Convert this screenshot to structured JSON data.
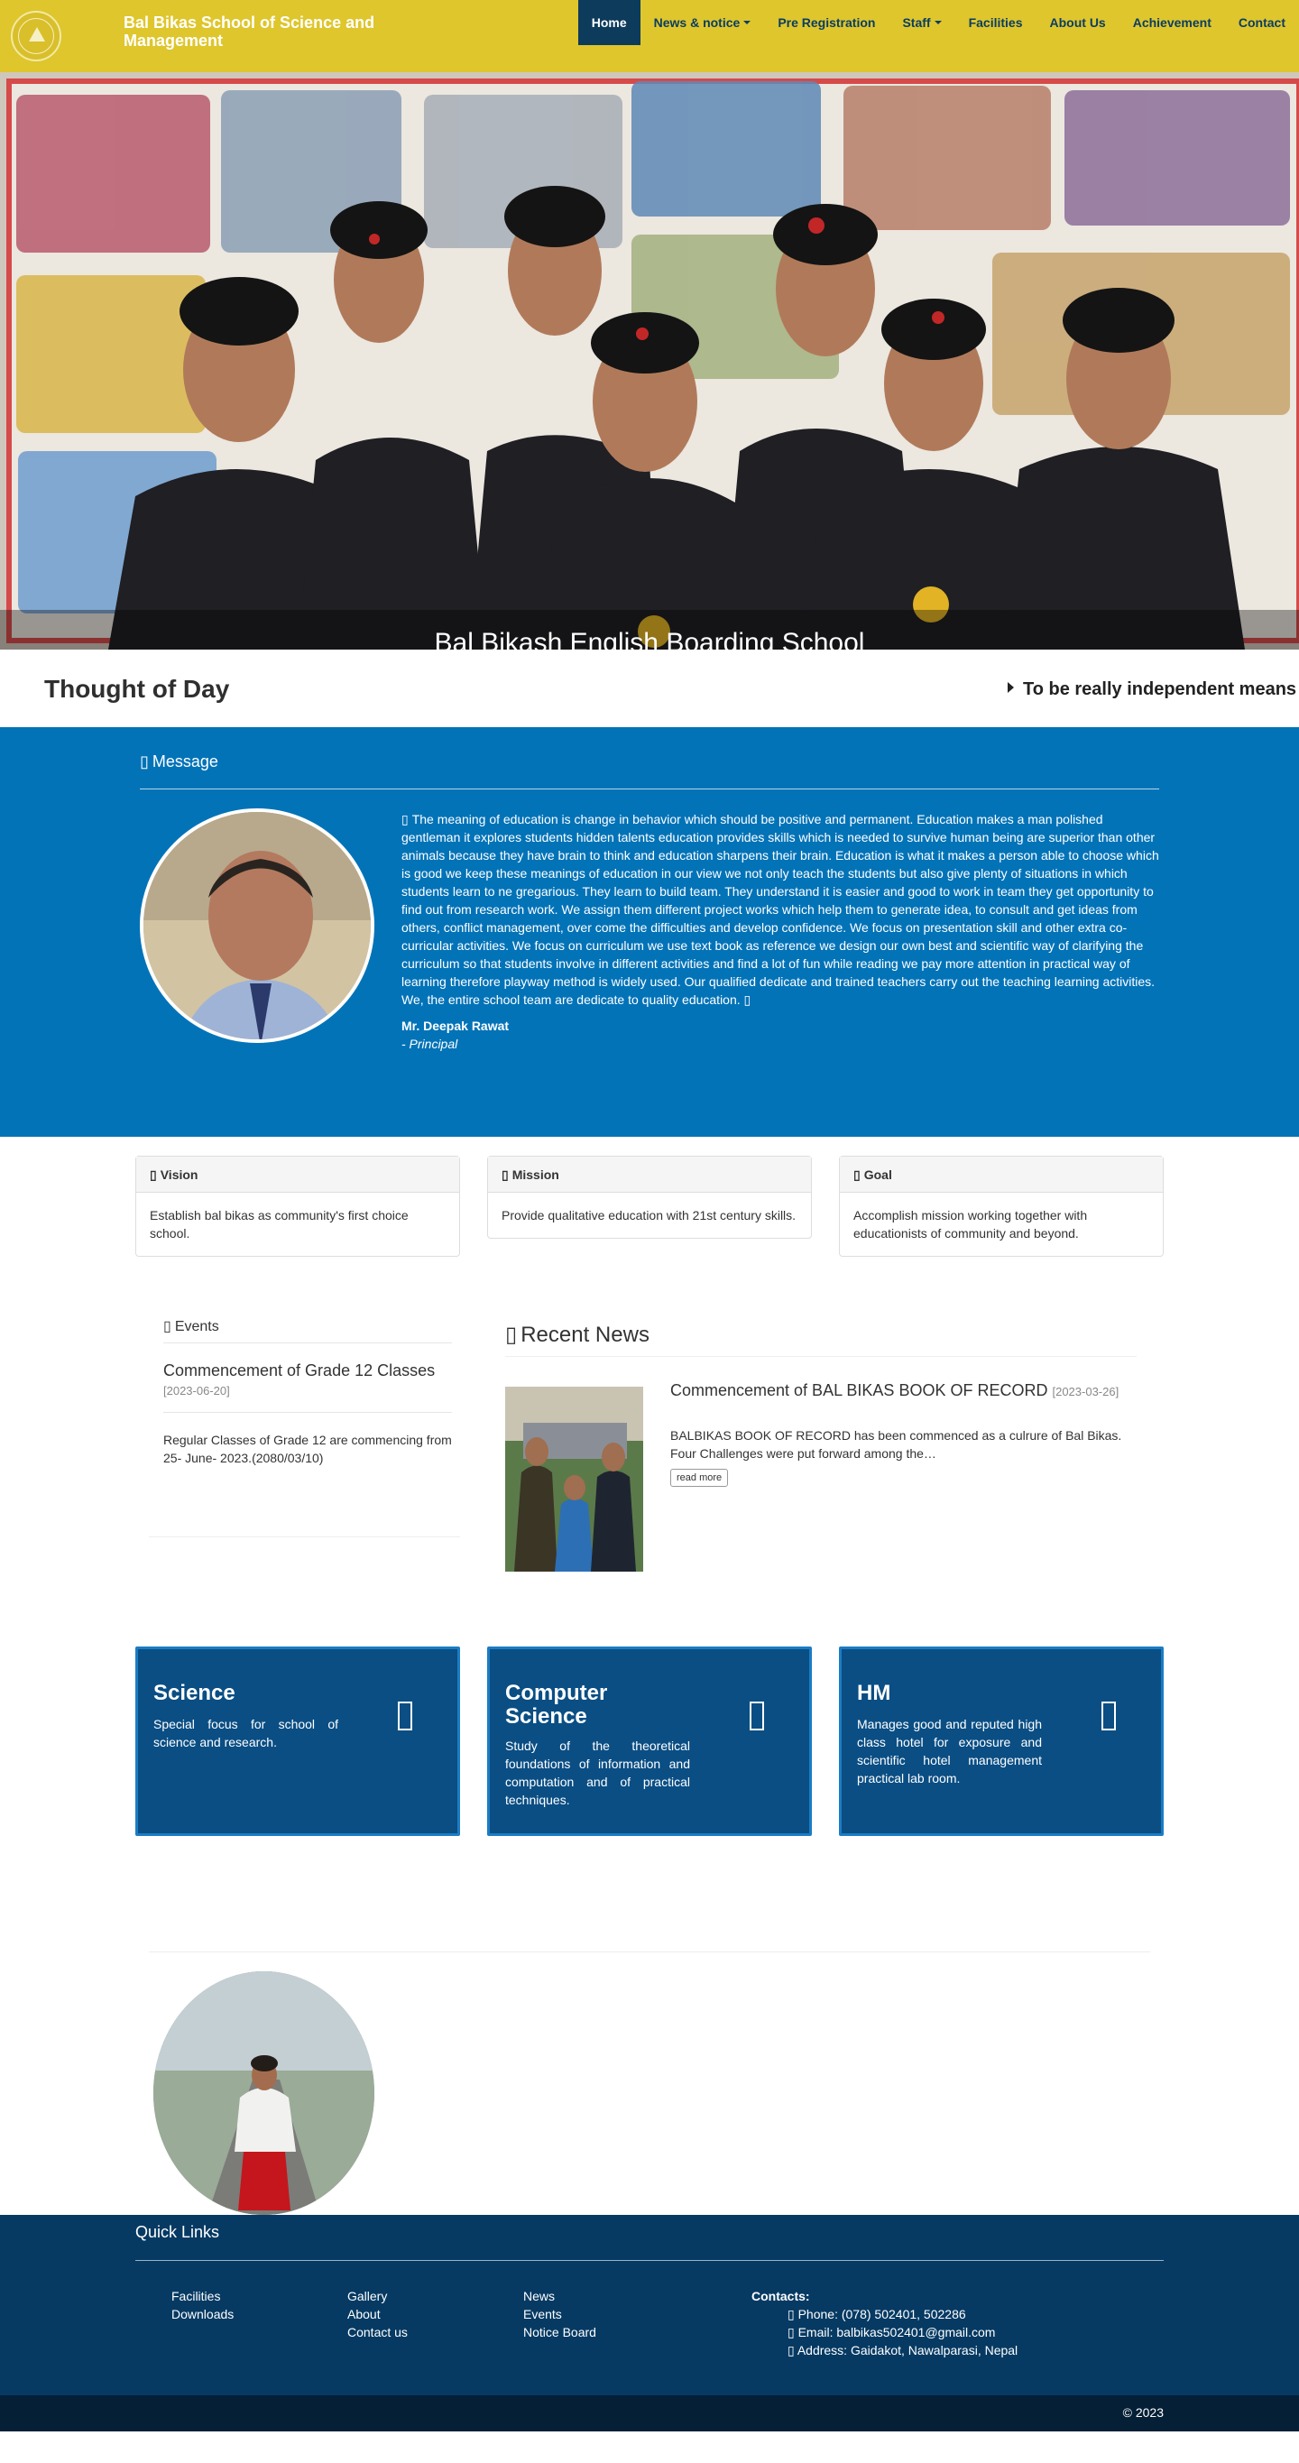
{
  "navbar": {
    "brand": "Bal Bikas School of Science and Management",
    "items": [
      {
        "label": "Home",
        "active": true
      },
      {
        "label": "News & notice",
        "caret": true
      },
      {
        "label": "Pre Registration"
      },
      {
        "label": "Staff",
        "caret": true
      },
      {
        "label": "Facilities"
      },
      {
        "label": "About Us"
      },
      {
        "label": "Achievement"
      },
      {
        "label": "Contact"
      }
    ]
  },
  "hero": {
    "caption": "Bal Bikash English Boarding School"
  },
  "thought": {
    "title": "Thought of Day",
    "text": "To be really independent means"
  },
  "message": {
    "heading": "Message",
    "text": "The meaning of education is change in behavior which should be positive and permanent. Education makes a man polished gentleman it explores students hidden talents education provides skills which is needed to survive human being are superior than other animals because they have brain to think and education sharpens their brain. Education is what it makes a person able to choose which is good we keep these meanings of education in our view we not only teach the students but also give plenty of situations in which students learn to ne gregarious. They learn to build team. They understand it is easier and good to work in team they get opportunity to find out from research work. We assign them different project works which help them to generate idea, to consult and get ideas from others, conflict management, over come the difficulties and develop confidence. We focus on presentation skill and other extra co-curricular activities. We focus on curriculum we use text book as reference we design our own best and scientific way of clarifying the curriculum so that students involve in different activities and find a lot of fun while reading we pay more attention in practical way of learning therefore playway method is widely used. Our qualified dedicate and trained teachers carry out the teaching learning activities. We, the entire school team are dedicate to quality education.",
    "name": "Mr. Deepak Rawat",
    "role": "- Principal"
  },
  "vmg": [
    {
      "title": "Vision",
      "body": "Establish bal bikas as community's first choice school."
    },
    {
      "title": "Mission",
      "body": "Provide qualitative education with 21st century skills."
    },
    {
      "title": "Goal",
      "body": "Accomplish mission working together with educationists of community and beyond."
    }
  ],
  "events": {
    "heading": "Events",
    "title": "Commencement of Grade 12 Classes",
    "date": "[2023-06-20]",
    "body": "Regular Classes of Grade 12 are commencing from 25- June- 2023.(2080/03/10)"
  },
  "news": {
    "heading": "Recent News",
    "title": "Commencement of BAL BIKAS BOOK OF RECORD",
    "date": "[2023-03-26]",
    "body": "BALBIKAS BOOK OF RECORD has been commenced as a culrure of Bal Bikas. Four Challenges were put forward among the…",
    "button": "read more"
  },
  "programs": [
    {
      "title": "Science",
      "body": "Special focus for school of science and research."
    },
    {
      "title": "Computer Science",
      "body": "Study of the theoretical foundations of information and computation and of practical techniques."
    },
    {
      "title": "HM",
      "body": "Manages good and reputed high class hotel for exposure and scientific hotel management practical lab room."
    }
  ],
  "footer": {
    "quick_links_title": "Quick Links",
    "col1": [
      "Facilities",
      "Downloads"
    ],
    "col2": [
      "Gallery",
      "About",
      "Contact us"
    ],
    "col3": [
      "News",
      "Events",
      "Notice Board"
    ],
    "contacts_label": "Contacts:",
    "phone": "Phone: (078) 502401, 502286",
    "email": "Email: balbikas502401@gmail.com",
    "address": "Address: Gaidakot, Nawalparasi, Nepal",
    "copyright": "© 2023"
  },
  "colors": {
    "navbar": "#dec62c",
    "nav_active": "#0c3b5c",
    "message_bg": "#0373b8",
    "program_bg": "#0a4e84",
    "footer_bg": "#063a63",
    "copyright_bg": "#041f36"
  },
  "icons": {
    "logo": "school-emblem",
    "message": "comment-icon",
    "vmg": "panel-icon",
    "events": "calendar-icon",
    "news": "newspaper-icon",
    "programs": "program-icon",
    "contacts": "contact-icon"
  }
}
